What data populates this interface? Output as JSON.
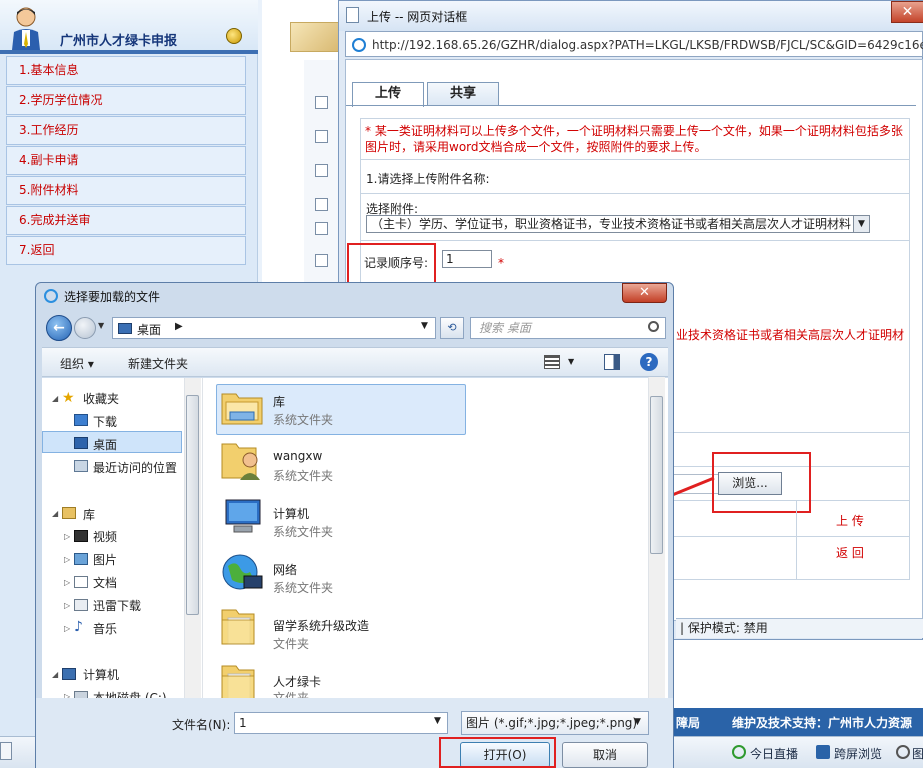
{
  "sidebar": {
    "title": "广州市人才绿卡申报",
    "items": [
      {
        "label": "1.基本信息"
      },
      {
        "label": "2.学历学位情况"
      },
      {
        "label": "3.工作经历"
      },
      {
        "label": "4.副卡申请"
      },
      {
        "label": "5.附件材料"
      },
      {
        "label": "6.完成并送审"
      },
      {
        "label": "7.返回"
      }
    ]
  },
  "upload_dialog": {
    "title": "上传 -- 网页对话框",
    "close": "✕",
    "url": "http://192.168.65.26/GZHR/dialog.aspx?PATH=LKGL/LKSB/FRDWSB/FJCL/SC&GID=6429c16e-4e",
    "tabs": [
      {
        "label": "上传"
      },
      {
        "label": "共享"
      }
    ],
    "notice": "* 某一类证明材料可以上传多个文件，一个证明材料只需要上传一个文件，如果一个证明材料包括多张图片时，请采用word文档合成一个文件，按照附件的要求上传。",
    "step1": "1.请选择上传附件名称:",
    "attach_label": "选择附件:",
    "attach_value": "（主卡）学历、学位证书，职业资格证书，专业技术资格证书或者相关高层次人才证明材料",
    "seq_label": "记录顺序号:",
    "seq_value": "1",
    "required_mark": "*",
    "attach_desc": "业技术资格证书或者相关高层次人才证明材",
    "browse_label": "浏览...",
    "upload_label": "上 传",
    "return_label": "返 回",
    "status": "| 保护模式: 禁用"
  },
  "picker": {
    "title": "选择要加载的文件",
    "close": "✕",
    "path": "桌面",
    "search_placeholder": "搜索 桌面",
    "organize": "组织 ▾",
    "new_folder": "新建文件夹",
    "help": "?",
    "nav": [
      {
        "label": "收藏夹"
      },
      {
        "label": "下载"
      },
      {
        "label": "桌面"
      },
      {
        "label": "最近访问的位置"
      },
      {
        "label": "库"
      },
      {
        "label": "视频"
      },
      {
        "label": "图片"
      },
      {
        "label": "文档"
      },
      {
        "label": "迅雷下载"
      },
      {
        "label": "音乐"
      },
      {
        "label": "计算机"
      },
      {
        "label": "本地磁盘 (C:)"
      }
    ],
    "files": [
      {
        "name": "库",
        "type": "系统文件夹"
      },
      {
        "name": "wangxw",
        "type": "系统文件夹"
      },
      {
        "name": "计算机",
        "type": "系统文件夹"
      },
      {
        "name": "网络",
        "type": "系统文件夹"
      },
      {
        "name": "留学系统升级改造",
        "type": "文件夹"
      },
      {
        "name": "人才绿卡",
        "type": "文件夹"
      }
    ],
    "filename_label": "文件名(N):",
    "filename_value": "1",
    "filetype_value": "图片 (*.gif;*.jpg;*.jpeg;*.png)",
    "open_label": "打开(O)",
    "cancel_label": "取消"
  },
  "footer": {
    "left_text": "障局",
    "right_text": "维护及技术支持：广州市人力资源"
  },
  "status_bar": {
    "items": [
      {
        "label": "今日直播"
      },
      {
        "label": "跨屏浏览"
      },
      {
        "label": "图"
      }
    ]
  },
  "colors": {
    "accent_red": "#e02020",
    "link_red": "#d10000",
    "brand_blue": "#2a63a8"
  }
}
